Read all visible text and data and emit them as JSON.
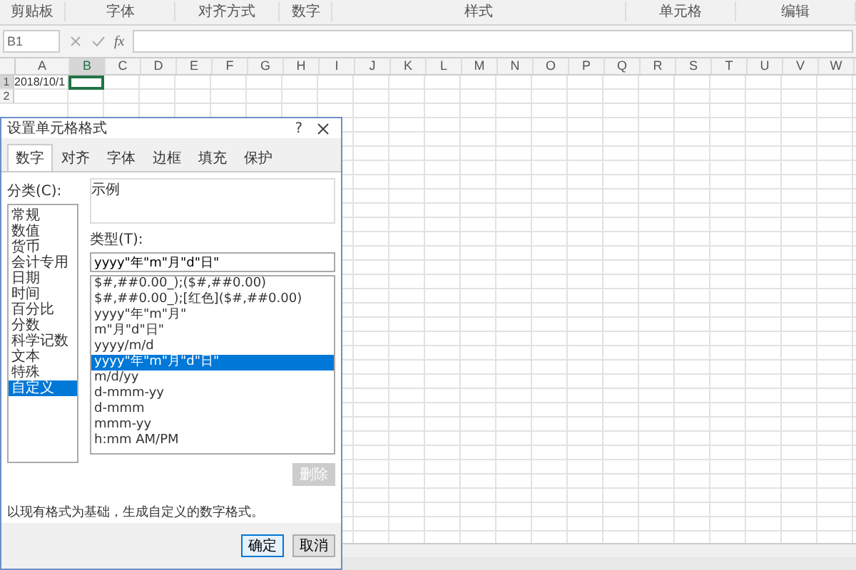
{
  "ribbon_groups": [
    "剪贴板",
    "字体",
    "对齐方式",
    "数字",
    "样式",
    "单元格",
    "编辑"
  ],
  "name_box": "B1",
  "formula_fx": "fx",
  "columns": [
    {
      "label": "A",
      "selected": false
    },
    {
      "label": "B",
      "selected": true
    },
    {
      "label": "C",
      "selected": false
    },
    {
      "label": "D",
      "selected": false
    },
    {
      "label": "E",
      "selected": false
    },
    {
      "label": "F",
      "selected": false
    },
    {
      "label": "G",
      "selected": false
    },
    {
      "label": "H",
      "selected": false
    },
    {
      "label": "I",
      "selected": false
    },
    {
      "label": "J",
      "selected": false
    },
    {
      "label": "K",
      "selected": false
    },
    {
      "label": "L",
      "selected": false
    },
    {
      "label": "M",
      "selected": false
    },
    {
      "label": "N",
      "selected": false
    },
    {
      "label": "O",
      "selected": false
    },
    {
      "label": "P",
      "selected": false
    },
    {
      "label": "Q",
      "selected": false
    },
    {
      "label": "R",
      "selected": false
    },
    {
      "label": "S",
      "selected": false
    },
    {
      "label": "T",
      "selected": false
    },
    {
      "label": "U",
      "selected": false
    },
    {
      "label": "V",
      "selected": false
    },
    {
      "label": "W",
      "selected": false
    }
  ],
  "rows": [
    {
      "label": "1",
      "selected": true,
      "cells": [
        "2018/10/1"
      ]
    },
    {
      "label": "2",
      "selected": false,
      "cells": []
    }
  ],
  "dialog": {
    "title": "设置单元格格式",
    "help": "?",
    "tabs": [
      {
        "label": "数字",
        "selected": true
      },
      {
        "label": "对齐",
        "selected": false
      },
      {
        "label": "字体",
        "selected": false
      },
      {
        "label": "边框",
        "selected": false
      },
      {
        "label": "填充",
        "selected": false
      },
      {
        "label": "保护",
        "selected": false
      }
    ],
    "category_label": "分类(C):",
    "categories": [
      {
        "label": "常规",
        "selected": false
      },
      {
        "label": "数值",
        "selected": false
      },
      {
        "label": "货币",
        "selected": false
      },
      {
        "label": "会计专用",
        "selected": false
      },
      {
        "label": "日期",
        "selected": false
      },
      {
        "label": "时间",
        "selected": false
      },
      {
        "label": "百分比",
        "selected": false
      },
      {
        "label": "分数",
        "selected": false
      },
      {
        "label": "科学记数",
        "selected": false
      },
      {
        "label": "文本",
        "selected": false
      },
      {
        "label": "特殊",
        "selected": false
      },
      {
        "label": "自定义",
        "selected": true
      }
    ],
    "sample_label": "示例",
    "type_label": "类型(T):",
    "type_value": "yyyy\"年\"m\"月\"d\"日\"",
    "types": [
      {
        "label": "$#,##0.00_);($#,##0.00)",
        "selected": false
      },
      {
        "label": "$#,##0.00_);[红色]($#,##0.00)",
        "selected": false
      },
      {
        "label": "yyyy\"年\"m\"月\"",
        "selected": false
      },
      {
        "label": "m\"月\"d\"日\"",
        "selected": false
      },
      {
        "label": "yyyy/m/d",
        "selected": false
      },
      {
        "label": "yyyy\"年\"m\"月\"d\"日\"",
        "selected": true
      },
      {
        "label": "m/d/yy",
        "selected": false
      },
      {
        "label": "d-mmm-yy",
        "selected": false
      },
      {
        "label": "d-mmm",
        "selected": false
      },
      {
        "label": "mmm-yy",
        "selected": false
      },
      {
        "label": "h:mm AM/PM",
        "selected": false
      }
    ],
    "delete_button": {
      "label": "删除",
      "disabled": true
    },
    "description": "以现有格式为基础，生成自定义的数字格式。",
    "ok": "确定",
    "cancel": "取消"
  }
}
